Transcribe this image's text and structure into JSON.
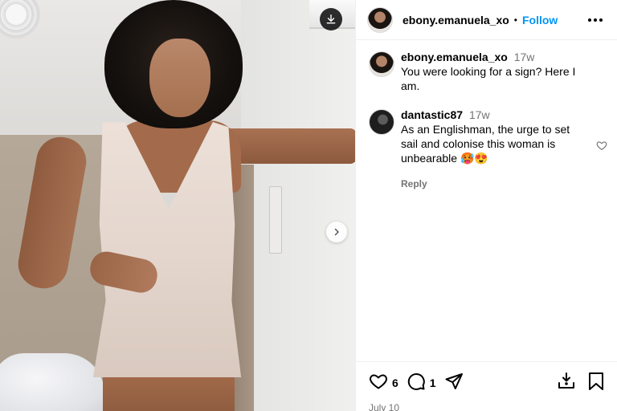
{
  "post": {
    "username": "ebony.emanuela_xo",
    "separator": "•",
    "follow_label": "Follow",
    "caption_time": "17w",
    "caption_text": "You were looking for a sign? Here I am.",
    "date": "July 10",
    "likes": "6",
    "comments_count": "1"
  },
  "comments": [
    {
      "username": "dantastic87",
      "time": "17w",
      "text": "As an Englishman, the urge to set sail and colonise this woman is unbearable 🥵😍",
      "reply_label": "Reply"
    }
  ],
  "icons": {
    "download": "download-icon",
    "next": "chevron-right-icon",
    "more": "more-options-icon",
    "like": "heart-icon",
    "comment": "comment-icon",
    "share": "send-icon",
    "save": "bookmark-icon",
    "tag": "tagged-user-icon"
  },
  "colors": {
    "accent": "#0095f6",
    "muted": "#737373",
    "border": "#efefef"
  }
}
